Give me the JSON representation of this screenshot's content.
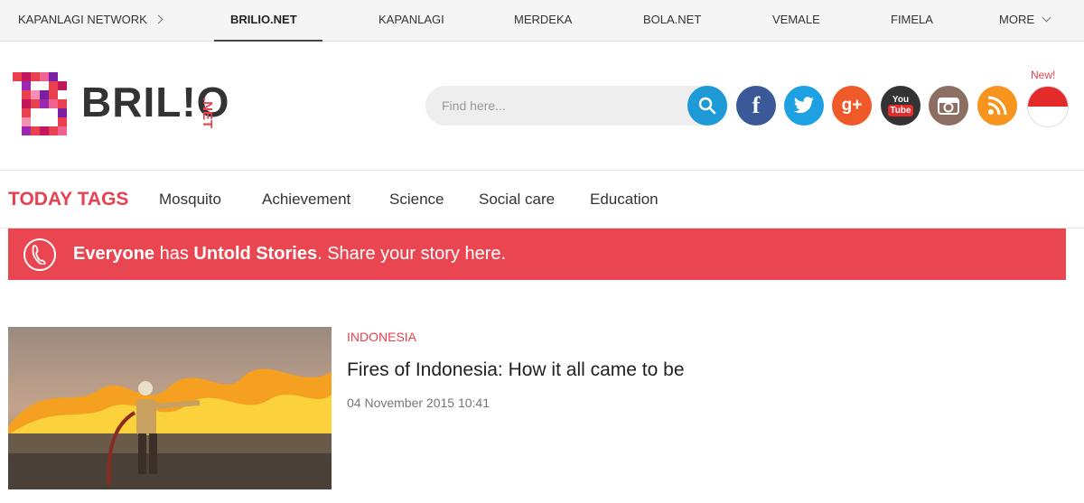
{
  "network": {
    "items": [
      {
        "label": "KAPANLAGI NETWORK"
      },
      {
        "label": "BRILIO.NET"
      },
      {
        "label": "KAPANLAGI"
      },
      {
        "label": "MERDEKA"
      },
      {
        "label": "BOLA.NET"
      },
      {
        "label": "VEMALE"
      },
      {
        "label": "FIMELA"
      },
      {
        "label": "MORE"
      }
    ],
    "active_index": 1
  },
  "header": {
    "logo_text": "BRIL!O",
    "logo_suffix": ".NET",
    "search_placeholder": "Find here...",
    "social_icons": [
      "facebook-icon",
      "twitter-icon",
      "googleplus-icon",
      "youtube-icon",
      "instagram-icon",
      "rss-icon"
    ],
    "new_label": "New!",
    "flag": "indonesia-flag-icon"
  },
  "tags": {
    "label": "TODAY TAGS",
    "items": [
      "Mosquito",
      "Achievement",
      "Science",
      "Social care",
      "Education"
    ]
  },
  "banner": {
    "part1": "Everyone",
    "part2": " has ",
    "part3": "Untold Stories",
    "part4": ". Share your story here."
  },
  "article": {
    "category": "INDONESIA",
    "title": "Fires of Indonesia: How it all came to be",
    "date": "04 November 2015 10:41"
  },
  "colors": {
    "accent": "#e9404f",
    "banner": "#ea4651",
    "search_button": "#1e9ad6",
    "facebook": "#3b5998",
    "twitter": "#1da1e2",
    "googleplus": "#f05a28",
    "youtube": "#333333",
    "instagram": "#8d6e63",
    "rss": "#f7941d"
  }
}
